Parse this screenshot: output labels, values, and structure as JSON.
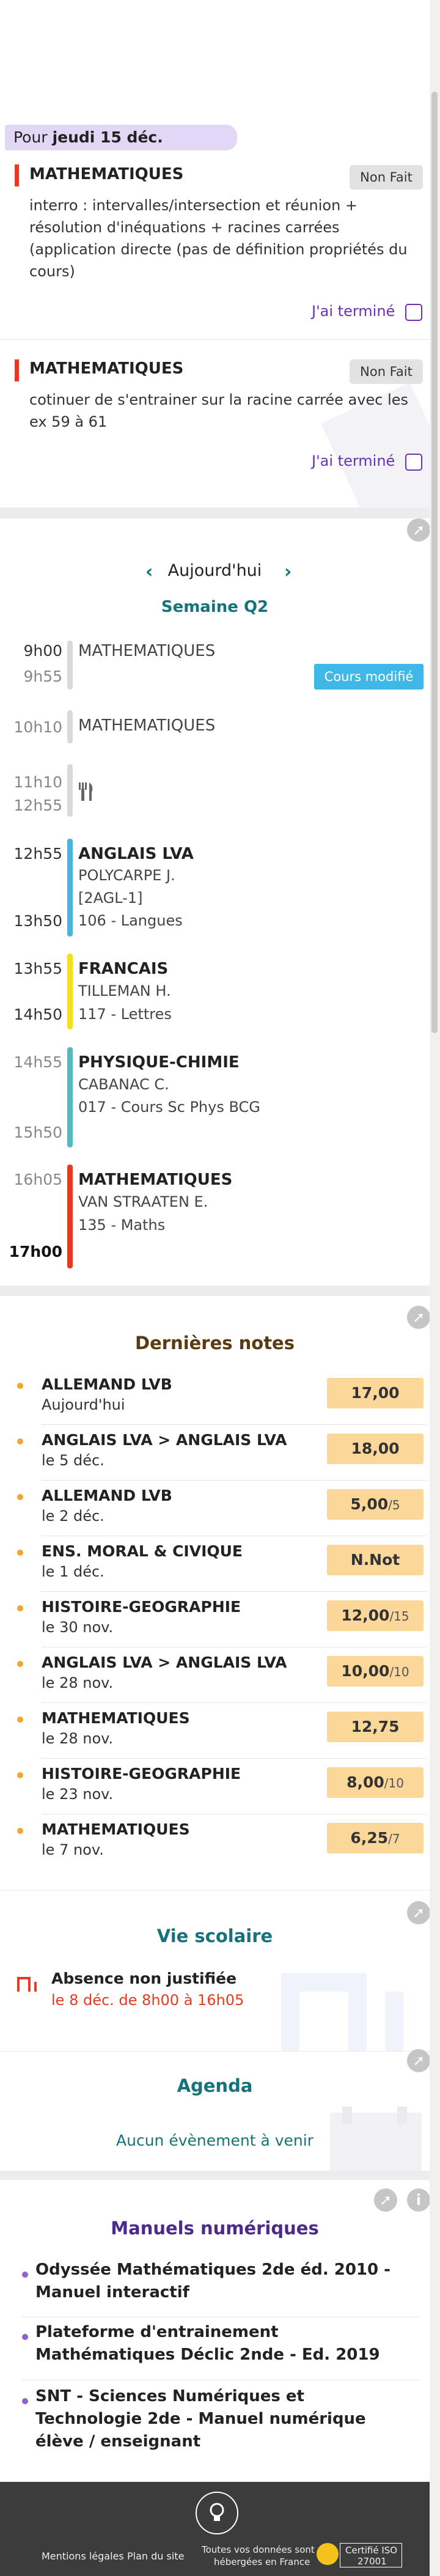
{
  "header": {
    "date_prefix": "Pour",
    "date_bold": "jeudi 15 déc."
  },
  "homework": [
    {
      "subject": "MATHEMATIQUES",
      "status": "Non Fait",
      "text": "interro : intervalles/intersection et réunion + résolution d'inéquations + racines carrées (application directe (pas de définition propriétés du cours)",
      "done_label": "J'ai terminé",
      "color": "#e53a23"
    },
    {
      "subject": "MATHEMATIQUES",
      "status": "Non Fait",
      "text": "cotinuer de s'entrainer sur la racine carrée avec les ex 59 à 61",
      "done_label": "J'ai terminé",
      "color": "#e53a23"
    }
  ],
  "timetable": {
    "day_label": "Aujourd'hui",
    "week_label": "Semaine Q2",
    "modified_badge": "Cours modifié",
    "courses": [
      {
        "start": "9h00",
        "end": "9h55",
        "subject": "MATHEMATIQUES",
        "teacher": "",
        "room": "",
        "extra": "",
        "color": "#d9d9d9"
      },
      {
        "start": "10h10",
        "end": "",
        "subject": "MATHEMATIQUES",
        "teacher": "",
        "room": "",
        "extra": "",
        "color": "#d9d9d9"
      },
      {
        "start": "11h10",
        "end": "12h55",
        "subject": "",
        "teacher": "",
        "room": "",
        "extra": "",
        "color": "#d9d9d9"
      },
      {
        "start": "12h55",
        "end": "13h50",
        "subject": "ANGLAIS LVA",
        "teacher": "POLYCARPE J.",
        "extra": "[2AGL-1]",
        "room": "106 - Langues",
        "color": "#4bb3dc"
      },
      {
        "start": "13h55",
        "end": "14h50",
        "subject": "FRANCAIS",
        "teacher": "TILLEMAN H.",
        "extra": "",
        "room": "117 - Lettres",
        "color": "#f4df1e"
      },
      {
        "start": "14h55",
        "end": "15h50",
        "subject": "PHYSIQUE-CHIMIE",
        "teacher": "CABANAC C.",
        "extra": "",
        "room": "017 - Cours Sc Phys BCG",
        "color": "#58b7b8"
      },
      {
        "start": "16h05",
        "end": "17h00",
        "subject": "MATHEMATIQUES",
        "teacher": "VAN STRAATEN E.",
        "extra": "",
        "room": "135 - Maths",
        "color": "#e53a23"
      }
    ]
  },
  "grades": {
    "title": "Dernières notes",
    "items": [
      {
        "subject": "ALLEMAND LVB",
        "date": "Aujourd'hui",
        "value": "17,00",
        "denominator": ""
      },
      {
        "subject": "ANGLAIS LVA > ANGLAIS LVA",
        "date": "le 5 déc.",
        "value": "18,00",
        "denominator": ""
      },
      {
        "subject": "ALLEMAND LVB",
        "date": "le 2 déc.",
        "value": "5,00",
        "denominator": "/5"
      },
      {
        "subject": "ENS. MORAL & CIVIQUE",
        "date": "le 1 déc.",
        "value": "N.Not",
        "denominator": ""
      },
      {
        "subject": "HISTOIRE-GEOGRAPHIE",
        "date": "le 30 nov.",
        "value": "12,00",
        "denominator": "/15"
      },
      {
        "subject": "ANGLAIS LVA > ANGLAIS LVA",
        "date": "le 28 nov.",
        "value": "10,00",
        "denominator": "/10"
      },
      {
        "subject": "MATHEMATIQUES",
        "date": "le 28 nov.",
        "value": "12,75",
        "denominator": ""
      },
      {
        "subject": "HISTOIRE-GEOGRAPHIE",
        "date": "le 23 nov.",
        "value": "8,00",
        "denominator": "/10"
      },
      {
        "subject": "MATHEMATIQUES",
        "date": "le 7 nov.",
        "value": "6,25",
        "denominator": "/7"
      }
    ]
  },
  "vie_scolaire": {
    "title": "Vie scolaire",
    "event_title": "Absence non justifiée",
    "event_detail": "le 8 déc. de 8h00 à 16h05"
  },
  "agenda": {
    "title": "Agenda",
    "empty": "Aucun évènement à venir"
  },
  "manuels": {
    "title": "Manuels numériques",
    "items": [
      "Odyssée Mathématiques 2de éd. 2010 - Manuel interactif",
      "Plateforme d'entrainement Mathématiques Déclic 2nde - Ed. 2019",
      "SNT - Sciences Numériques et Technologie 2de - Manuel numérique élève / enseignant"
    ]
  },
  "footer": {
    "legal": "Mentions légales",
    "plan": "Plan du site",
    "hosting_line1": "Toutes vos données sont",
    "hosting_line2": "hébergées en France",
    "iso_line1": "Certifié ISO",
    "iso_line2": "27001"
  },
  "colors": {
    "accent_purple": "#6a32b0",
    "teal": "#17727a",
    "grade_box": "#fcd79a",
    "red": "#e53a23",
    "modified_badge": "#3fb8e8"
  }
}
